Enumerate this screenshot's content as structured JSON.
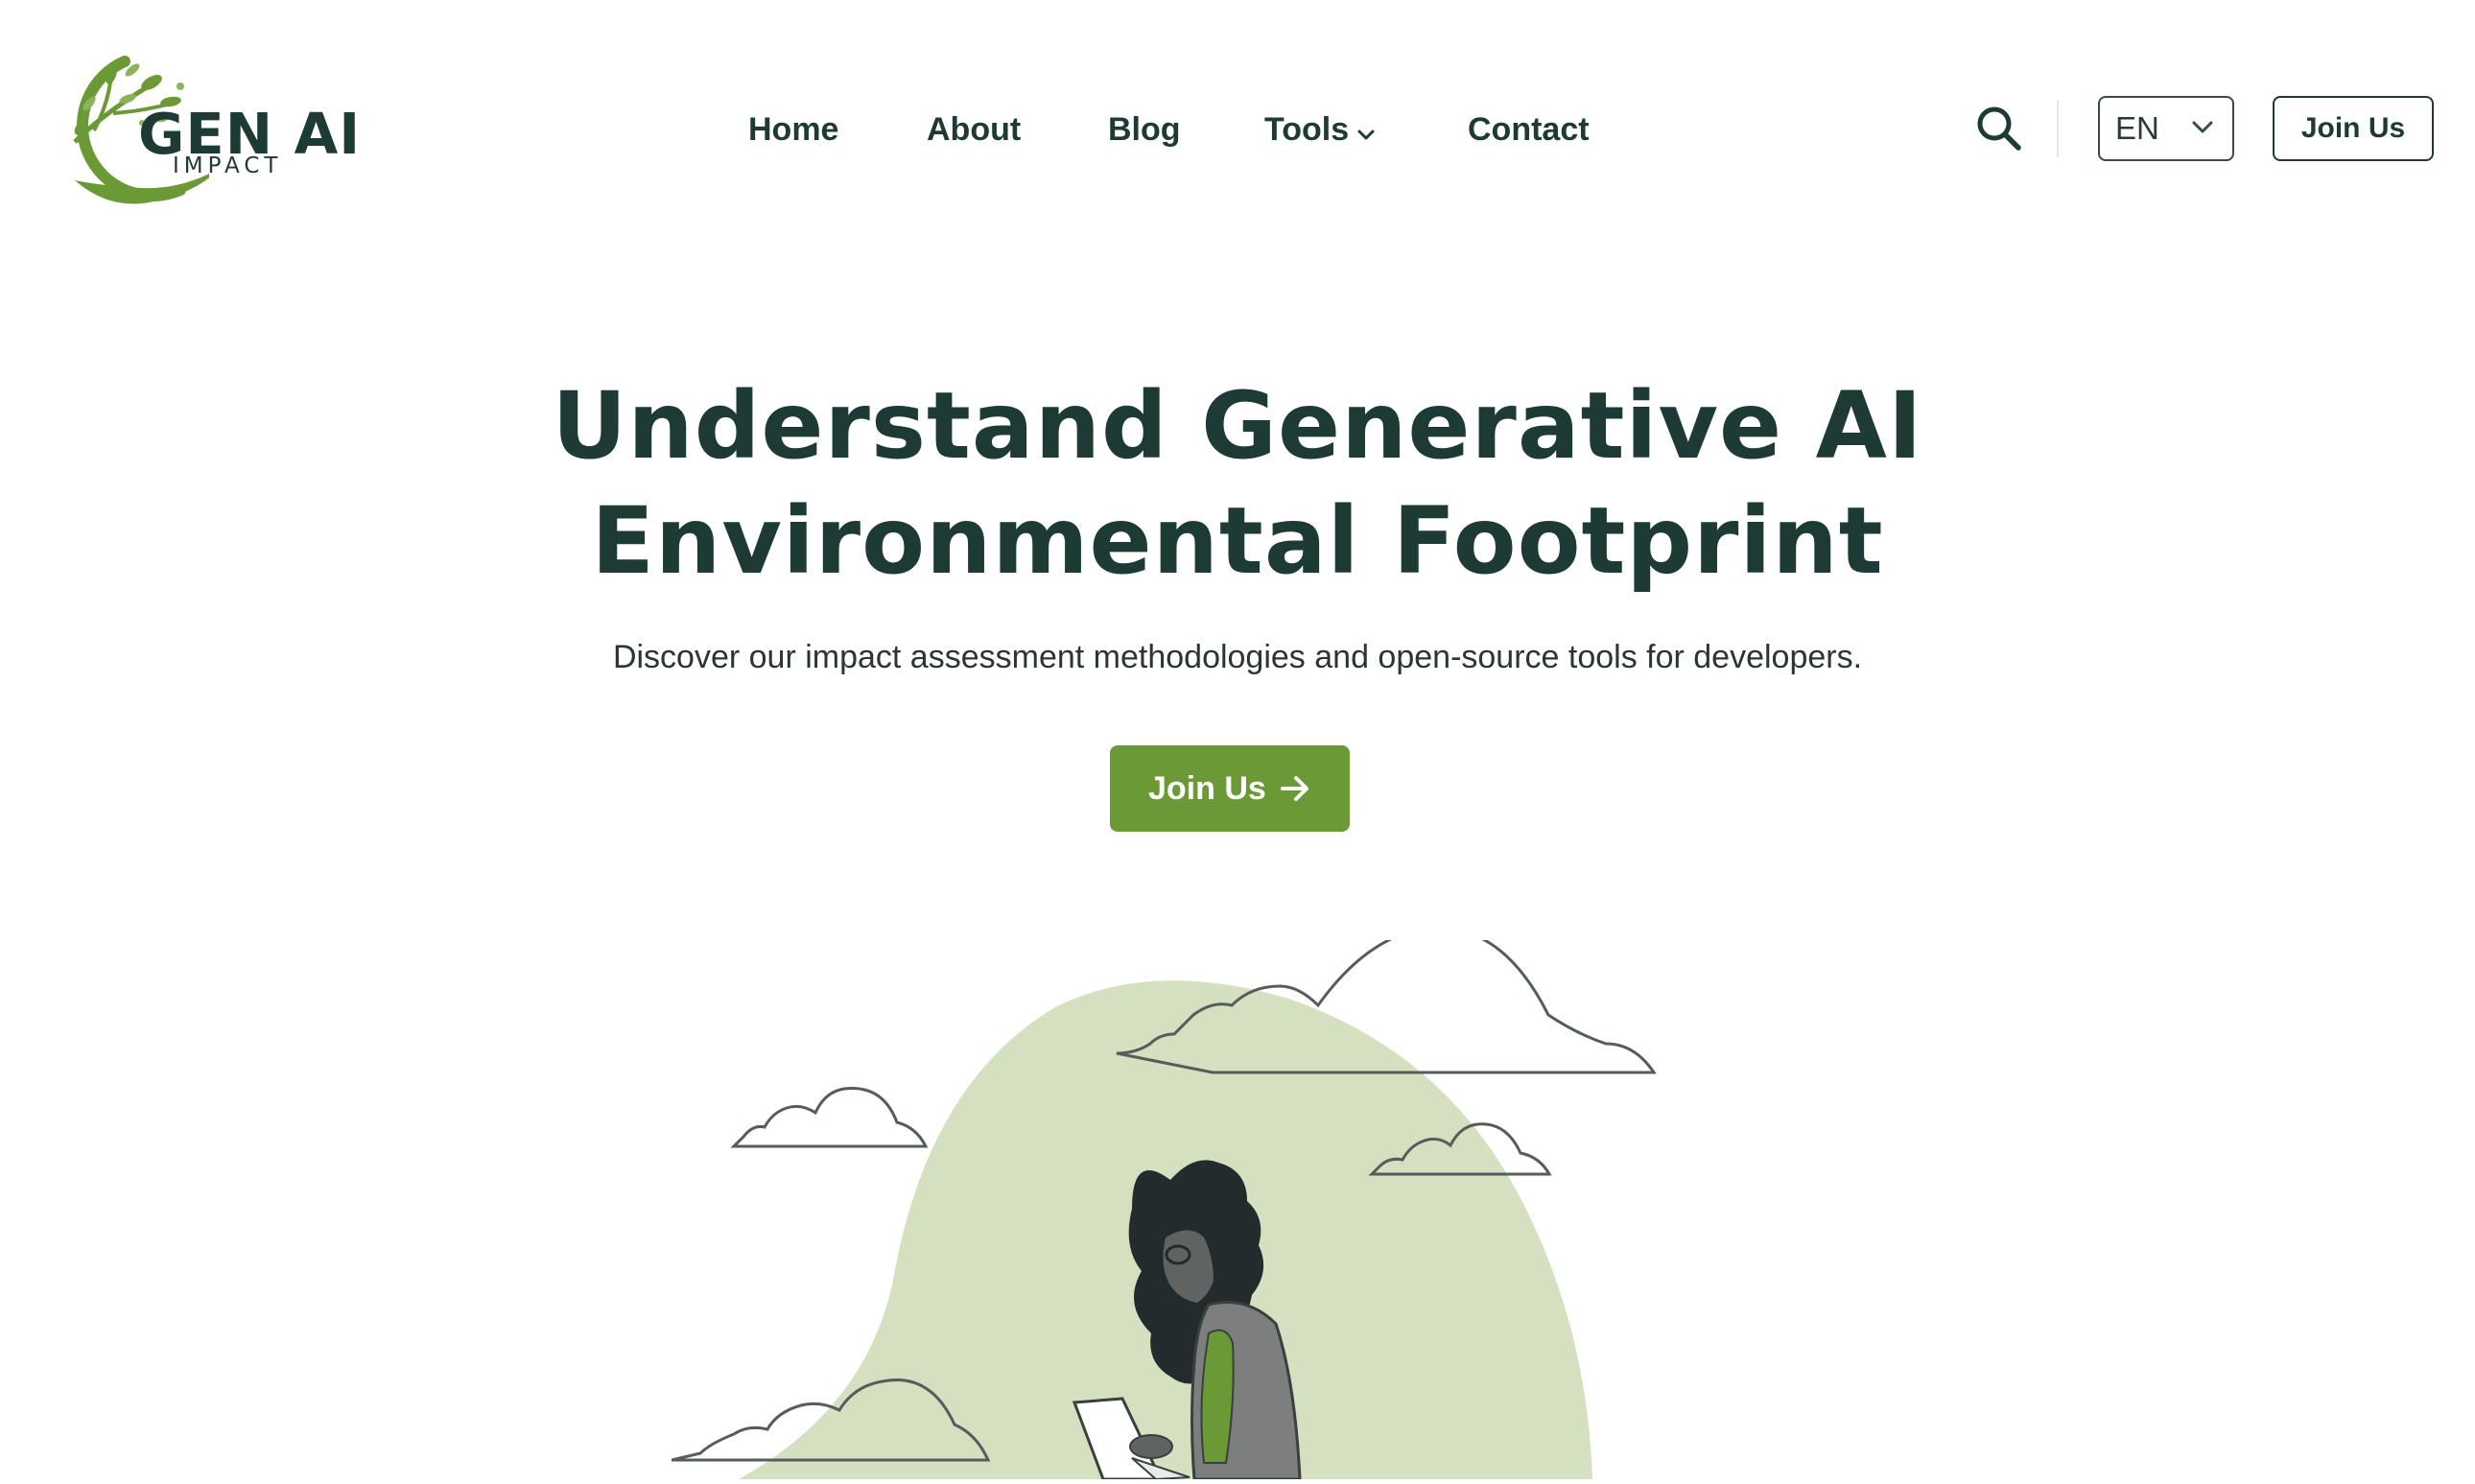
{
  "brand": {
    "title": "GEN AI",
    "subtitle": "IMPACT",
    "logo_icon": "tree-hand-logo-icon",
    "color_primary": "#1e3a34",
    "color_accent": "#6b9935",
    "color_illustration_bg": "#d4e0c0"
  },
  "nav": {
    "items": [
      {
        "label": "Home"
      },
      {
        "label": "About"
      },
      {
        "label": "Blog"
      },
      {
        "label": "Tools",
        "has_dropdown": true
      },
      {
        "label": "Contact"
      }
    ]
  },
  "header": {
    "search_icon": "search-icon",
    "language": {
      "value": "EN",
      "icon": "chevron-down-icon"
    },
    "join_label": "Join Us"
  },
  "hero": {
    "title_line1": "Understand Generative AI",
    "title_line2": "Environmental Footprint",
    "subtitle": "Discover our impact assessment methodologies and open-source tools for developers.",
    "cta_label": "Join Us",
    "cta_icon": "arrow-right-icon",
    "illustration": "woman-with-laptop-and-clouds-illustration"
  }
}
